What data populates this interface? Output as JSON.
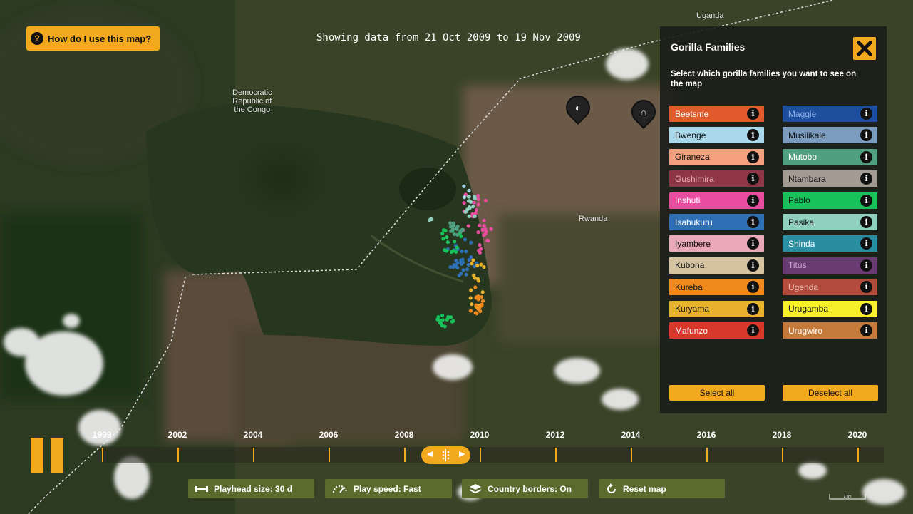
{
  "help": {
    "label": "How do I use this map?",
    "icon": "question-icon"
  },
  "date_range": "Showing data from 21 Oct 2009 to 19 Nov 2009",
  "map_labels": {
    "drc": "Democratic\nRepublic of\nthe Congo",
    "uganda": "Uganda",
    "rwanda": "Rwanda"
  },
  "panel": {
    "title": "Gorilla Families",
    "subtitle": "Select which gorilla families you want to see on the map",
    "close_icon": "close-icon",
    "select_all": "Select all",
    "deselect_all": "Deselect all",
    "info_glyph": "i",
    "families_left": [
      {
        "name": "Beetsme",
        "color": "#e05a2b",
        "text": "#fff"
      },
      {
        "name": "Bwenge",
        "color": "#a9d8ea",
        "text": "#111"
      },
      {
        "name": "Giraneza",
        "color": "#f4a07f",
        "text": "#111"
      },
      {
        "name": "Gushimira",
        "color": "#8e3546",
        "text": "#e8b0b8"
      },
      {
        "name": "Inshuti",
        "color": "#e84da0",
        "text": "#fff"
      },
      {
        "name": "Isabukuru",
        "color": "#2f6fb3",
        "text": "#fff"
      },
      {
        "name": "Iyambere",
        "color": "#eaa9b9",
        "text": "#111"
      },
      {
        "name": "Kubona",
        "color": "#d6c3a0",
        "text": "#111"
      },
      {
        "name": "Kureba",
        "color": "#f08a1c",
        "text": "#111"
      },
      {
        "name": "Kuryama",
        "color": "#e9b22d",
        "text": "#111"
      },
      {
        "name": "Mafunzo",
        "color": "#d7382a",
        "text": "#fff"
      }
    ],
    "families_right": [
      {
        "name": "Maggie",
        "color": "#1d4f9e",
        "text": "#8fb0e6"
      },
      {
        "name": "Musilikale",
        "color": "#7b9cbf",
        "text": "#111"
      },
      {
        "name": "Mutobo",
        "color": "#4f9f80",
        "text": "#fff"
      },
      {
        "name": "Ntambara",
        "color": "#a39a92",
        "text": "#111"
      },
      {
        "name": "Pablo",
        "color": "#17c25a",
        "text": "#111"
      },
      {
        "name": "Pasika",
        "color": "#8fcfbe",
        "text": "#111"
      },
      {
        "name": "Shinda",
        "color": "#2a8da1",
        "text": "#fff"
      },
      {
        "name": "Titus",
        "color": "#6a3a73",
        "text": "#c8a9cf"
      },
      {
        "name": "Ugenda",
        "color": "#b34c3c",
        "text": "#f0c2b8"
      },
      {
        "name": "Urugamba",
        "color": "#f6ef2a",
        "text": "#111"
      },
      {
        "name": "Urugwiro",
        "color": "#c47a3a",
        "text": "#fff"
      }
    ]
  },
  "timeline": {
    "years": [
      "1999",
      "2002",
      "2004",
      "2006",
      "2008",
      "2010",
      "2012",
      "2014",
      "2016",
      "2018",
      "2020"
    ],
    "pause_icon": "pause-icon",
    "playhead_icon": "playhead-drag-icon"
  },
  "controls": {
    "playhead_size": "Playhead size: 30 d",
    "play_speed": "Play speed: Fast",
    "country_borders": "Country borders: On",
    "reset_map": "Reset map"
  },
  "scale_label": "2 km",
  "accent": "#f2a91e"
}
